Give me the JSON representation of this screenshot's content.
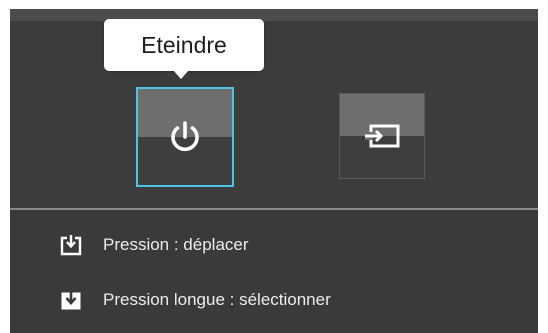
{
  "tooltip": {
    "label": "Eteindre"
  },
  "menu": {
    "items": [
      {
        "id": "power",
        "icon": "power-icon",
        "selected": true
      },
      {
        "id": "source",
        "icon": "input-source-icon",
        "selected": false
      }
    ]
  },
  "guide": {
    "press": {
      "icon": "joystick-press-icon",
      "label": "Pression : déplacer"
    },
    "long_press": {
      "icon": "joystick-long-press-icon",
      "label": "Pression longue : sélectionner"
    }
  },
  "colors": {
    "panel_bg": "#3a3a3a",
    "tile_top": "#6e6e6e",
    "tile_bottom": "#3e3e3e",
    "selection_accent": "#4fc3e6",
    "tooltip_bg": "#ffffff",
    "text": "#ececec"
  }
}
